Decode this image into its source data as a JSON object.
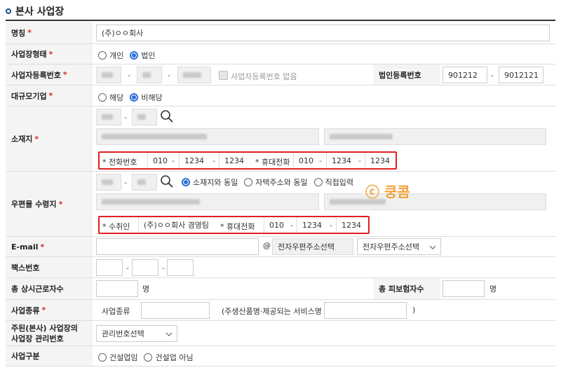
{
  "section": {
    "title": "본사 사업장"
  },
  "required_mark": "*",
  "name": {
    "label": "명칭",
    "value": "(주)ㅇㅇ회사"
  },
  "biz_type": {
    "label": "사업장형태",
    "options": [
      "개인",
      "법인"
    ],
    "selected": "법인"
  },
  "biz_reg": {
    "label": "사업자등록번호",
    "no_number_label": "사업자등록번호 없음",
    "corp_label": "법인등록번호",
    "corp_part1": "901212",
    "corp_part2": "9012121"
  },
  "large_company": {
    "label": "대규모기업",
    "options": [
      "해당",
      "비해당"
    ],
    "selected": "비해당"
  },
  "location": {
    "label": "소재지",
    "phone_label": "* 전화번호",
    "phone": [
      "010",
      "1234",
      "1234"
    ],
    "mobile_label": "* 휴대전화",
    "mobile": [
      "010",
      "1234",
      "1234"
    ]
  },
  "mail_addr": {
    "label": "우편물 수령지",
    "options": [
      "소재지와 동일",
      "자택주소와 동일",
      "직접입력"
    ],
    "selected": "소재지와 동일",
    "recipient_label": "* 수취인",
    "recipient": "(주)ㅇㅇ회사 경영팀",
    "mobile_label": "* 휴대전화",
    "mobile": [
      "010",
      "1234",
      "1234"
    ]
  },
  "watermark": "ⓒ 쿵콤",
  "email": {
    "label": "E-mail",
    "at": "@",
    "domain_field": "전자우편주소선택",
    "domain_select": "전자우편주소선택"
  },
  "fax": {
    "label": "팩스번호"
  },
  "workers": {
    "label": "총 상시근로자수",
    "unit": "명",
    "insured_label": "총 피보험자수",
    "insured_unit": "명"
  },
  "industry": {
    "label": "사업종류",
    "field_label": "사업종류",
    "note_open": "(주생산품명·제공되는 서비스명",
    "note_close": ")"
  },
  "mgmt_no": {
    "label": "주된(본사) 사업장의 사업장 관리번호",
    "select": "관리번호선택"
  },
  "biz_class": {
    "label": "사업구분",
    "options": [
      "건설업임",
      "건설업 아님"
    ]
  },
  "dash": "-"
}
